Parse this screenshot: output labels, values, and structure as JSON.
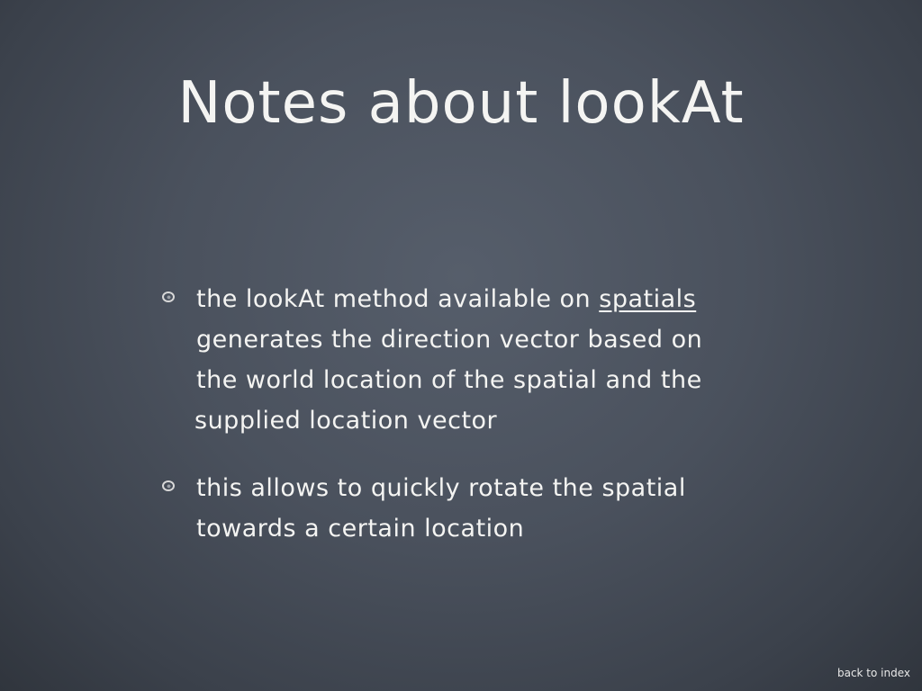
{
  "slide": {
    "title": "Notes about lookAt",
    "bullets": [
      {
        "line1_pre": "the lookAt method available on ",
        "line1_link": "spatials",
        "line2": "generates the direction vector based on",
        "line3": "the world location of the spatial and the",
        "line4": "supplied location vector"
      },
      {
        "line1": "this allows to quickly rotate the spatial",
        "line2": "towards a certain location"
      }
    ],
    "back_link": "back to index"
  }
}
